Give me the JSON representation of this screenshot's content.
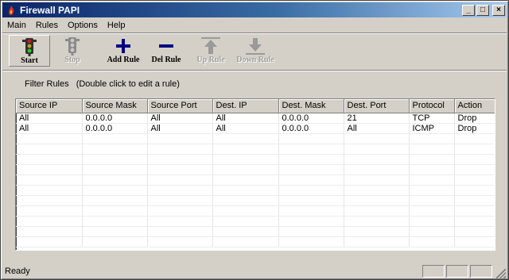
{
  "window": {
    "title": "Firewall PAPI",
    "minimize_glyph": "_",
    "maximize_glyph": "□",
    "close_glyph": "×"
  },
  "menu": [
    "Main",
    "Rules",
    "Options",
    "Help"
  ],
  "toolbar": {
    "start": "Start",
    "stop": "Stop",
    "add_rule": "Add Rule",
    "del_rule": "Del Rule",
    "up_rule": "Up Rule",
    "down_rule": "Down Rule",
    "icons": {
      "start": "traffic-light-icon",
      "stop": "traffic-light-icon",
      "add_rule": "plus-icon",
      "del_rule": "minus-icon",
      "up_rule": "arrow-up-icon",
      "down_rule": "arrow-down-icon"
    }
  },
  "filter": {
    "label": "Filter Rules",
    "hint": "(Double click to edit a rule)"
  },
  "table": {
    "columns": [
      "Source IP",
      "Source Mask",
      "Source Port",
      "Dest. IP",
      "Dest. Mask",
      "Dest. Port",
      "Protocol",
      "Action"
    ],
    "rows": [
      [
        "All",
        "0.0.0.0",
        "All",
        "All",
        "0.0.0.0",
        "21",
        "TCP",
        "Drop"
      ],
      [
        "All",
        "0.0.0.0",
        "All",
        "All",
        "0.0.0.0",
        "All",
        "ICMP",
        "Drop"
      ]
    ]
  },
  "status": {
    "text": "Ready"
  },
  "colors": {
    "titlebar_start": "#0a246a",
    "titlebar_end": "#a6caf0",
    "chrome": "#d4d0c8",
    "add_icon": "#000080",
    "del_icon": "#000080"
  }
}
